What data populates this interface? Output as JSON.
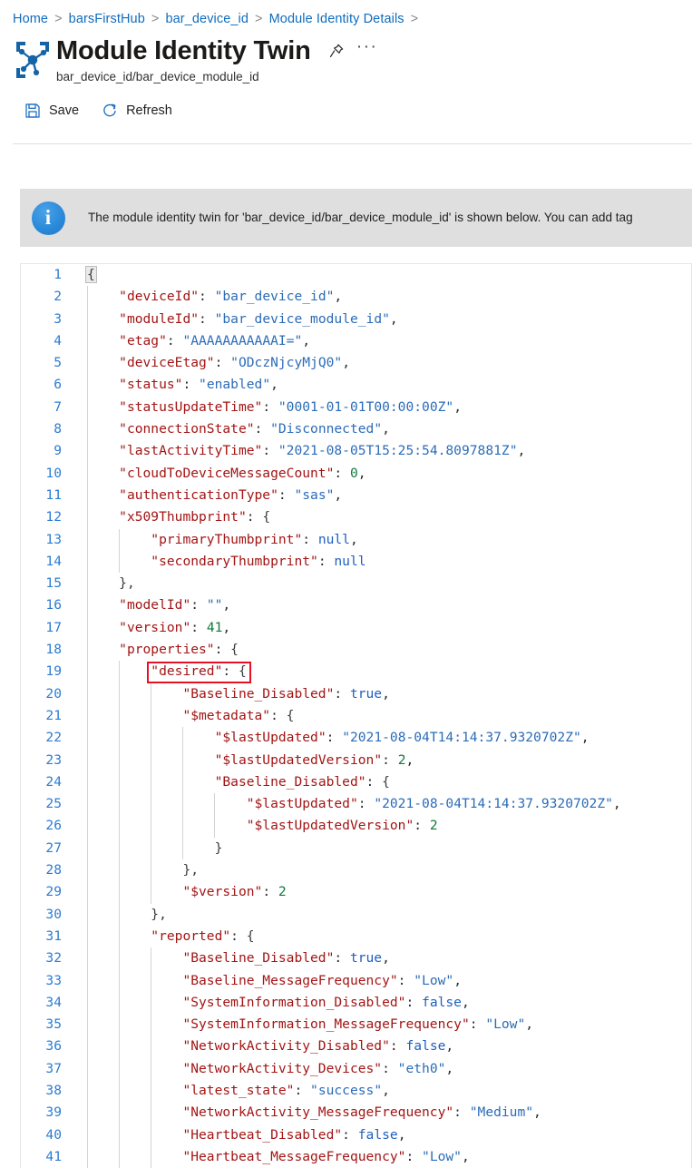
{
  "breadcrumb": {
    "items": [
      "Home",
      "barsFirstHub",
      "bar_device_id",
      "Module Identity Details"
    ],
    "separator": ">",
    "trailing_separator": ">"
  },
  "header": {
    "icon": "module-identity-twin-icon",
    "title": "Module Identity Twin",
    "subtitle": "bar_device_id/bar_device_module_id",
    "pin_icon": "pin-icon",
    "more_label": "···"
  },
  "toolbar": {
    "save_label": "Save",
    "save_icon": "save-floppy-icon",
    "refresh_label": "Refresh",
    "refresh_icon": "refresh-circular-arrow-icon"
  },
  "banner": {
    "icon": "info-icon",
    "icon_glyph": "i",
    "text": "The module identity twin for 'bar_device_id/bar_device_module_id' is shown below. You can add tag"
  },
  "editor": {
    "highlight_annotation": {
      "target_line": 19,
      "target_token": "\"desired\": {",
      "color": "#e81123"
    },
    "lines": [
      {
        "n": 1,
        "indent": 0,
        "tokens": [
          {
            "t": "brace-match",
            "v": "{"
          }
        ]
      },
      {
        "n": 2,
        "indent": 1,
        "tokens": [
          {
            "t": "key",
            "v": "\"deviceId\""
          },
          {
            "t": "punc",
            "v": ": "
          },
          {
            "t": "str",
            "v": "\"bar_device_id\""
          },
          {
            "t": "punc",
            "v": ","
          }
        ]
      },
      {
        "n": 3,
        "indent": 1,
        "tokens": [
          {
            "t": "key",
            "v": "\"moduleId\""
          },
          {
            "t": "punc",
            "v": ": "
          },
          {
            "t": "str",
            "v": "\"bar_device_module_id\""
          },
          {
            "t": "punc",
            "v": ","
          }
        ]
      },
      {
        "n": 4,
        "indent": 1,
        "tokens": [
          {
            "t": "key",
            "v": "\"etag\""
          },
          {
            "t": "punc",
            "v": ": "
          },
          {
            "t": "str",
            "v": "\"AAAAAAAAAAAI=\""
          },
          {
            "t": "punc",
            "v": ","
          }
        ]
      },
      {
        "n": 5,
        "indent": 1,
        "tokens": [
          {
            "t": "key",
            "v": "\"deviceEtag\""
          },
          {
            "t": "punc",
            "v": ": "
          },
          {
            "t": "str",
            "v": "\"ODczNjcyMjQ0\""
          },
          {
            "t": "punc",
            "v": ","
          }
        ]
      },
      {
        "n": 6,
        "indent": 1,
        "tokens": [
          {
            "t": "key",
            "v": "\"status\""
          },
          {
            "t": "punc",
            "v": ": "
          },
          {
            "t": "str",
            "v": "\"enabled\""
          },
          {
            "t": "punc",
            "v": ","
          }
        ]
      },
      {
        "n": 7,
        "indent": 1,
        "tokens": [
          {
            "t": "key",
            "v": "\"statusUpdateTime\""
          },
          {
            "t": "punc",
            "v": ": "
          },
          {
            "t": "str",
            "v": "\"0001-01-01T00:00:00Z\""
          },
          {
            "t": "punc",
            "v": ","
          }
        ]
      },
      {
        "n": 8,
        "indent": 1,
        "tokens": [
          {
            "t": "key",
            "v": "\"connectionState\""
          },
          {
            "t": "punc",
            "v": ": "
          },
          {
            "t": "str",
            "v": "\"Disconnected\""
          },
          {
            "t": "punc",
            "v": ","
          }
        ]
      },
      {
        "n": 9,
        "indent": 1,
        "tokens": [
          {
            "t": "key",
            "v": "\"lastActivityTime\""
          },
          {
            "t": "punc",
            "v": ": "
          },
          {
            "t": "str",
            "v": "\"2021-08-05T15:25:54.8097881Z\""
          },
          {
            "t": "punc",
            "v": ","
          }
        ]
      },
      {
        "n": 10,
        "indent": 1,
        "tokens": [
          {
            "t": "key",
            "v": "\"cloudToDeviceMessageCount\""
          },
          {
            "t": "punc",
            "v": ": "
          },
          {
            "t": "num",
            "v": "0"
          },
          {
            "t": "punc",
            "v": ","
          }
        ]
      },
      {
        "n": 11,
        "indent": 1,
        "tokens": [
          {
            "t": "key",
            "v": "\"authenticationType\""
          },
          {
            "t": "punc",
            "v": ": "
          },
          {
            "t": "str",
            "v": "\"sas\""
          },
          {
            "t": "punc",
            "v": ","
          }
        ]
      },
      {
        "n": 12,
        "indent": 1,
        "tokens": [
          {
            "t": "key",
            "v": "\"x509Thumbprint\""
          },
          {
            "t": "punc",
            "v": ": "
          },
          {
            "t": "brace",
            "v": "{"
          }
        ]
      },
      {
        "n": 13,
        "indent": 2,
        "tokens": [
          {
            "t": "key",
            "v": "\"primaryThumbprint\""
          },
          {
            "t": "punc",
            "v": ": "
          },
          {
            "t": "lit",
            "v": "null"
          },
          {
            "t": "punc",
            "v": ","
          }
        ]
      },
      {
        "n": 14,
        "indent": 2,
        "tokens": [
          {
            "t": "key",
            "v": "\"secondaryThumbprint\""
          },
          {
            "t": "punc",
            "v": ": "
          },
          {
            "t": "lit",
            "v": "null"
          }
        ]
      },
      {
        "n": 15,
        "indent": 1,
        "tokens": [
          {
            "t": "brace",
            "v": "},"
          }
        ]
      },
      {
        "n": 16,
        "indent": 1,
        "tokens": [
          {
            "t": "key",
            "v": "\"modelId\""
          },
          {
            "t": "punc",
            "v": ": "
          },
          {
            "t": "str",
            "v": "\"\""
          },
          {
            "t": "punc",
            "v": ","
          }
        ]
      },
      {
        "n": 17,
        "indent": 1,
        "tokens": [
          {
            "t": "key",
            "v": "\"version\""
          },
          {
            "t": "punc",
            "v": ": "
          },
          {
            "t": "num",
            "v": "41"
          },
          {
            "t": "punc",
            "v": ","
          }
        ]
      },
      {
        "n": 18,
        "indent": 1,
        "tokens": [
          {
            "t": "key",
            "v": "\"properties\""
          },
          {
            "t": "punc",
            "v": ": "
          },
          {
            "t": "brace",
            "v": "{"
          }
        ]
      },
      {
        "n": 19,
        "indent": 2,
        "tokens": [
          {
            "t": "key",
            "v": "\"desired\""
          },
          {
            "t": "punc",
            "v": ": "
          },
          {
            "t": "brace",
            "v": "{"
          }
        ]
      },
      {
        "n": 20,
        "indent": 3,
        "tokens": [
          {
            "t": "key",
            "v": "\"Baseline_Disabled\""
          },
          {
            "t": "punc",
            "v": ": "
          },
          {
            "t": "lit",
            "v": "true"
          },
          {
            "t": "punc",
            "v": ","
          }
        ]
      },
      {
        "n": 21,
        "indent": 3,
        "tokens": [
          {
            "t": "key",
            "v": "\"$metadata\""
          },
          {
            "t": "punc",
            "v": ": "
          },
          {
            "t": "brace",
            "v": "{"
          }
        ]
      },
      {
        "n": 22,
        "indent": 4,
        "tokens": [
          {
            "t": "key",
            "v": "\"$lastUpdated\""
          },
          {
            "t": "punc",
            "v": ": "
          },
          {
            "t": "str",
            "v": "\"2021-08-04T14:14:37.9320702Z\""
          },
          {
            "t": "punc",
            "v": ","
          }
        ]
      },
      {
        "n": 23,
        "indent": 4,
        "tokens": [
          {
            "t": "key",
            "v": "\"$lastUpdatedVersion\""
          },
          {
            "t": "punc",
            "v": ": "
          },
          {
            "t": "num",
            "v": "2"
          },
          {
            "t": "punc",
            "v": ","
          }
        ]
      },
      {
        "n": 24,
        "indent": 4,
        "tokens": [
          {
            "t": "key",
            "v": "\"Baseline_Disabled\""
          },
          {
            "t": "punc",
            "v": ": "
          },
          {
            "t": "brace",
            "v": "{"
          }
        ]
      },
      {
        "n": 25,
        "indent": 5,
        "tokens": [
          {
            "t": "key",
            "v": "\"$lastUpdated\""
          },
          {
            "t": "punc",
            "v": ": "
          },
          {
            "t": "str",
            "v": "\"2021-08-04T14:14:37.9320702Z\""
          },
          {
            "t": "punc",
            "v": ","
          }
        ]
      },
      {
        "n": 26,
        "indent": 5,
        "tokens": [
          {
            "t": "key",
            "v": "\"$lastUpdatedVersion\""
          },
          {
            "t": "punc",
            "v": ": "
          },
          {
            "t": "num",
            "v": "2"
          }
        ]
      },
      {
        "n": 27,
        "indent": 4,
        "tokens": [
          {
            "t": "brace",
            "v": "}"
          }
        ]
      },
      {
        "n": 28,
        "indent": 3,
        "tokens": [
          {
            "t": "brace",
            "v": "},"
          }
        ]
      },
      {
        "n": 29,
        "indent": 3,
        "tokens": [
          {
            "t": "key",
            "v": "\"$version\""
          },
          {
            "t": "punc",
            "v": ": "
          },
          {
            "t": "num",
            "v": "2"
          }
        ]
      },
      {
        "n": 30,
        "indent": 2,
        "tokens": [
          {
            "t": "brace",
            "v": "},"
          }
        ]
      },
      {
        "n": 31,
        "indent": 2,
        "tokens": [
          {
            "t": "key",
            "v": "\"reported\""
          },
          {
            "t": "punc",
            "v": ": "
          },
          {
            "t": "brace",
            "v": "{"
          }
        ]
      },
      {
        "n": 32,
        "indent": 3,
        "tokens": [
          {
            "t": "key",
            "v": "\"Baseline_Disabled\""
          },
          {
            "t": "punc",
            "v": ": "
          },
          {
            "t": "lit",
            "v": "true"
          },
          {
            "t": "punc",
            "v": ","
          }
        ]
      },
      {
        "n": 33,
        "indent": 3,
        "tokens": [
          {
            "t": "key",
            "v": "\"Baseline_MessageFrequency\""
          },
          {
            "t": "punc",
            "v": ": "
          },
          {
            "t": "str",
            "v": "\"Low\""
          },
          {
            "t": "punc",
            "v": ","
          }
        ]
      },
      {
        "n": 34,
        "indent": 3,
        "tokens": [
          {
            "t": "key",
            "v": "\"SystemInformation_Disabled\""
          },
          {
            "t": "punc",
            "v": ": "
          },
          {
            "t": "lit",
            "v": "false"
          },
          {
            "t": "punc",
            "v": ","
          }
        ]
      },
      {
        "n": 35,
        "indent": 3,
        "tokens": [
          {
            "t": "key",
            "v": "\"SystemInformation_MessageFrequency\""
          },
          {
            "t": "punc",
            "v": ": "
          },
          {
            "t": "str",
            "v": "\"Low\""
          },
          {
            "t": "punc",
            "v": ","
          }
        ]
      },
      {
        "n": 36,
        "indent": 3,
        "tokens": [
          {
            "t": "key",
            "v": "\"NetworkActivity_Disabled\""
          },
          {
            "t": "punc",
            "v": ": "
          },
          {
            "t": "lit",
            "v": "false"
          },
          {
            "t": "punc",
            "v": ","
          }
        ]
      },
      {
        "n": 37,
        "indent": 3,
        "tokens": [
          {
            "t": "key",
            "v": "\"NetworkActivity_Devices\""
          },
          {
            "t": "punc",
            "v": ": "
          },
          {
            "t": "str",
            "v": "\"eth0\""
          },
          {
            "t": "punc",
            "v": ","
          }
        ]
      },
      {
        "n": 38,
        "indent": 3,
        "tokens": [
          {
            "t": "key",
            "v": "\"latest_state\""
          },
          {
            "t": "punc",
            "v": ": "
          },
          {
            "t": "str",
            "v": "\"success\""
          },
          {
            "t": "punc",
            "v": ","
          }
        ]
      },
      {
        "n": 39,
        "indent": 3,
        "tokens": [
          {
            "t": "key",
            "v": "\"NetworkActivity_MessageFrequency\""
          },
          {
            "t": "punc",
            "v": ": "
          },
          {
            "t": "str",
            "v": "\"Medium\""
          },
          {
            "t": "punc",
            "v": ","
          }
        ]
      },
      {
        "n": 40,
        "indent": 3,
        "tokens": [
          {
            "t": "key",
            "v": "\"Heartbeat_Disabled\""
          },
          {
            "t": "punc",
            "v": ": "
          },
          {
            "t": "lit",
            "v": "false"
          },
          {
            "t": "punc",
            "v": ","
          }
        ]
      },
      {
        "n": 41,
        "indent": 3,
        "tokens": [
          {
            "t": "key",
            "v": "\"Heartbeat_MessageFrequency\""
          },
          {
            "t": "punc",
            "v": ": "
          },
          {
            "t": "str",
            "v": "\"Low\""
          },
          {
            "t": "punc",
            "v": ","
          }
        ]
      }
    ]
  }
}
